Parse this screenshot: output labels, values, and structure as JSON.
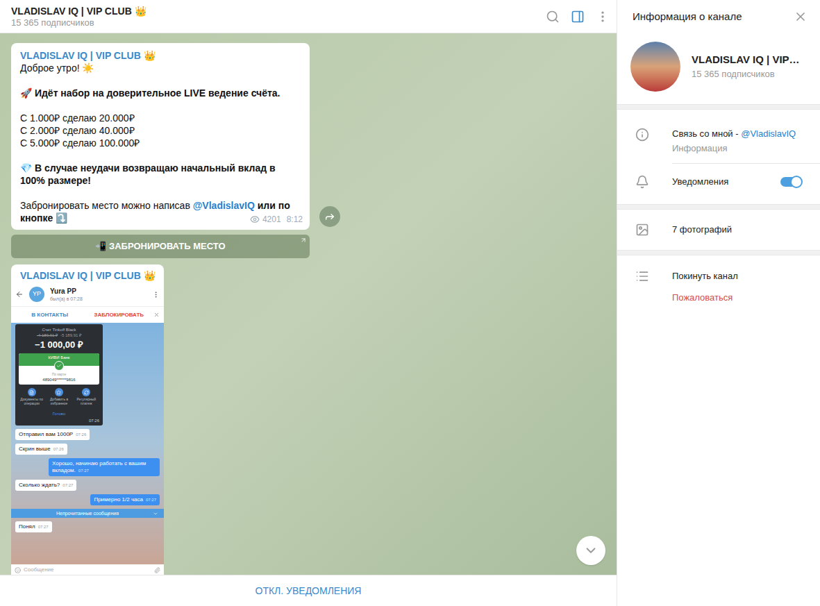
{
  "header": {
    "title": "VLADISLAV IQ | VIP CLUB 👑",
    "subtitle": "15 365 подписчиков",
    "panel_open": true
  },
  "post": {
    "sender": "VLADISLAV IQ | VIP CLUB 👑",
    "paragraphs": [
      [
        [
          {
            "text": "Доброе утро! ☀️",
            "kind": "normal"
          }
        ]
      ],
      [
        [
          {
            "text": "🚀 Идёт набор на доверительное LIVE ведение счёта.",
            "kind": "bold"
          }
        ]
      ],
      [
        [
          {
            "text": "С 1.000₽ сделаю 20.000₽",
            "kind": "normal"
          }
        ],
        [
          {
            "text": "С 2.000₽ сделаю 40.000₽",
            "kind": "normal"
          }
        ],
        [
          {
            "text": "С 5.000₽ сделаю 100.000₽",
            "kind": "normal"
          }
        ]
      ],
      [
        [
          {
            "text": "💎 В случае неудачи возвращаю начальный вклад в 100% размере!",
            "kind": "bold"
          }
        ]
      ],
      [
        [
          {
            "text": "Забронировать место можно написав ",
            "kind": "normal"
          },
          {
            "text": "@VladislavIQ",
            "kind": "link"
          },
          {
            "text": " или по кнопке",
            "kind": "bold"
          },
          {
            "text": " ⤵️",
            "kind": "normal"
          }
        ]
      ]
    ],
    "views": "4201",
    "time": "8:12",
    "button": "📲 ЗАБРОНИРОВАТЬ МЕСТО"
  },
  "photo_post": {
    "sender": "VLADISLAV IQ | VIP CLUB 👑",
    "screenshot": {
      "contact": "Yura PP",
      "avatar": "YP",
      "status": "был(а) в 07:28",
      "actions": [
        {
          "label": "В КОНТАКТЫ",
          "color": "#3a8ac9"
        },
        {
          "label": "ЗАБЛОКИРОВАТЬ",
          "color": "#e0463c"
        }
      ],
      "receipt": {
        "account": "Счет Tinkoff Black",
        "balance_old": "-4 189,91 ₽",
        "balance_new": "-5 189,91 ₽",
        "amount": "−1 000,00 ₽",
        "bank": "КИВИ Банк",
        "method": "По карте",
        "card": "489049******9816",
        "actions": [
          "Документы по операции",
          "Добавить в избранное",
          "Регулярный платеж"
        ],
        "done": "Готово",
        "time": "07:26"
      },
      "items": [
        {
          "kind": "message",
          "text": "Отправил вам 1000Р",
          "time": "07:26",
          "outgoing": false
        },
        {
          "kind": "message",
          "text": "Скрин выше",
          "time": "07:26",
          "outgoing": false
        },
        {
          "kind": "message",
          "text": "Хорошо, начинаю работать с вашим вкладом.",
          "time": "07:27",
          "outgoing": true
        },
        {
          "kind": "message",
          "text": "Сколько ждать?",
          "time": "07:27",
          "outgoing": false
        },
        {
          "kind": "message",
          "text": "Примерно 1/2 часа",
          "time": "07:27",
          "outgoing": true
        },
        {
          "kind": "divider",
          "text": "Непрочитанные сообщения",
          "time": "",
          "outgoing": false
        },
        {
          "kind": "message",
          "text": "Понял",
          "time": "07:27",
          "outgoing": false
        }
      ],
      "input_placeholder": "Сообщение"
    }
  },
  "bottom_bar": {
    "label": "ОТКЛ. УВЕДОМЛЕНИЯ"
  },
  "info_panel": {
    "title": "Информация о канале",
    "name": "VLADISLAV IQ | VIP…",
    "subscribers": "15 365 подписчиков",
    "info": {
      "text": "Связь со мной - ",
      "link": "@VladislavIQ",
      "label": "Информация"
    },
    "notifications": {
      "label": "Уведомления",
      "on": true
    },
    "photos": "7 фотографий",
    "leave": "Покинуть канал",
    "report": "Пожаловаться"
  }
}
